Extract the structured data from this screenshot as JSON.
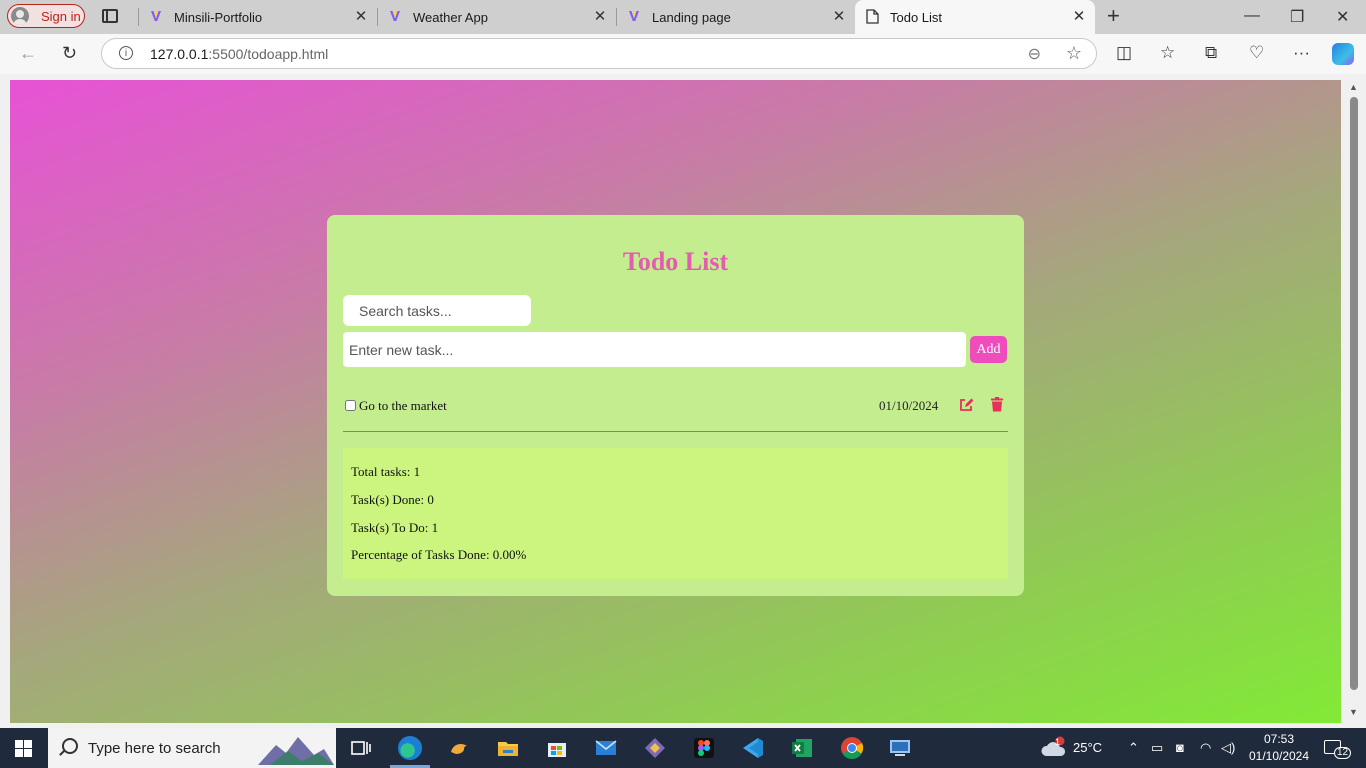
{
  "browser": {
    "sign_in_label": "Sign in",
    "tabs": [
      {
        "title": "Minsili-Portfolio",
        "icon": "vite-icon"
      },
      {
        "title": "Weather App",
        "icon": "vite-icon"
      },
      {
        "title": "Landing page",
        "icon": "vite-icon"
      },
      {
        "title": "Todo List",
        "icon": "page-icon",
        "active": true
      }
    ],
    "address": {
      "host": "127.0.0.1",
      "rest": ":5500/todoapp.html"
    }
  },
  "app": {
    "title": "Todo List",
    "search_placeholder": "Search tasks...",
    "new_task_placeholder": "Enter new task...",
    "add_label": "Add",
    "tasks": [
      {
        "text": "Go to the market",
        "date": "01/10/2024",
        "done": false
      }
    ],
    "stats": {
      "total": "Total tasks: 1",
      "done": "Task(s) Done: 0",
      "todo": "Task(s) To Do: 1",
      "percent": "Percentage of Tasks Done: 0.00%"
    },
    "colors": {
      "title": "#e45cb0",
      "accent": "#ee4dbb",
      "icon": "#e8305a",
      "card": "#c3ed8f",
      "stats": "#cbf57e"
    }
  },
  "taskbar": {
    "search_placeholder": "Type here to search",
    "weather": "25°C",
    "weather_badge": "1",
    "time": "07:53",
    "date": "01/10/2024",
    "notification_count": "12"
  }
}
